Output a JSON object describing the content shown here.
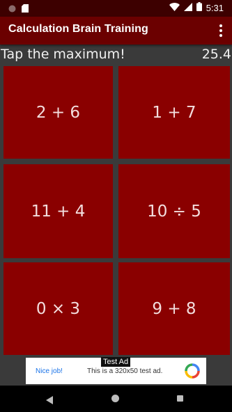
{
  "status_bar": {
    "time": "5:31",
    "icons": [
      "circle-notification-icon",
      "sd-card-icon",
      "wifi-icon",
      "cellular-signal-icon",
      "battery-icon"
    ]
  },
  "app_bar": {
    "title": "Calculation Brain Training",
    "menu_icon": "more-vert-icon"
  },
  "game": {
    "instruction": "Tap the maximum!",
    "timer": "25.4",
    "tiles": [
      "2 + 6",
      "1 + 7",
      "11 + 4",
      "10 ÷ 5",
      "0 × 3",
      "9 + 8"
    ]
  },
  "ad_banner": {
    "badge": "Test Ad",
    "headline": "Nice job!",
    "description": "This is a 320x50 test ad."
  },
  "nav_bar": {
    "icons": [
      "back-icon",
      "home-icon",
      "recents-icon"
    ]
  },
  "colors": {
    "status_bar": "#3d0000",
    "app_bar": "#6b0000",
    "tile": "#8a0000",
    "background": "#3a3a3a"
  }
}
